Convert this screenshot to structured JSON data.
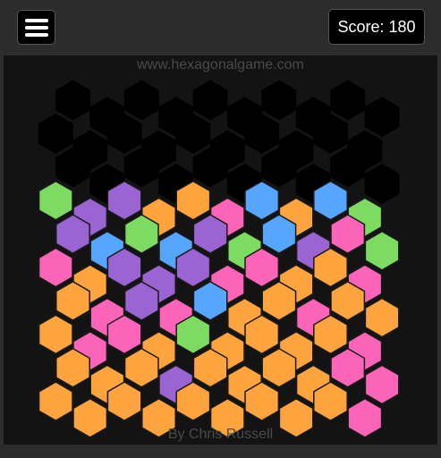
{
  "header": {
    "menu_icon": "hamburger-menu-icon",
    "score_label": "Score: 180"
  },
  "board": {
    "site_url": "www.hexagonalgame.com",
    "credit": "By Chris Russell",
    "colors": {
      "G": "#7ddb62",
      "P": "#9a64d3",
      "O": "#fda43e",
      "K": "#fb64b8",
      "B": "#56a6ff",
      "E": "#000000"
    },
    "rows": [
      "EEEEEEEEEE",
      "EEEEEEEEEE",
      "EEEEEEEEEE",
      "GPPOOKBOBG",
      "PBGBPGBPKG",
      "KOPPPKKOOK",
      "OKPKBOOKOO",
      "OKKOGOOOOK",
      "OOOPOOOOKK",
      "OOOOOOOOOK"
    ]
  }
}
